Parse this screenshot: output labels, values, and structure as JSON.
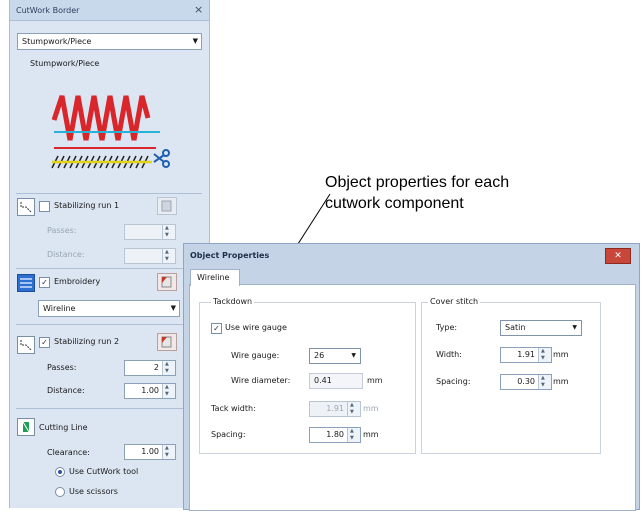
{
  "docker": {
    "title": "CutWork Border",
    "close": "×",
    "stitch_type_value": "Stumpwork/Piece",
    "preview_caption": "Stumpwork/Piece",
    "stabilizing_run_1": {
      "label": "Stabilizing run 1",
      "checked": false,
      "passes_label": "Passes:",
      "distance_label": "Distance:"
    },
    "embroidery": {
      "label": "Embroidery",
      "checked": true,
      "type_value": "Wireline"
    },
    "stabilizing_run_2": {
      "label": "Stabilizing run 2",
      "checked": true,
      "passes_label": "Passes:",
      "passes_value": "2",
      "distance_label": "Distance:",
      "distance_value": "1.00"
    },
    "cutting_line": {
      "label": "Cutting Line",
      "clearance_label": "Clearance:",
      "clearance_value": "1.00",
      "option_cutwork": "Use CutWork tool",
      "option_scissors": "Use scissors",
      "selected": "Use CutWork tool"
    }
  },
  "dialog": {
    "title": "Object Properties",
    "close": "✕",
    "tab": "Wireline",
    "tackdown": {
      "title": "Tackdown",
      "use_wire_gauge_label": "Use wire gauge",
      "use_wire_gauge_checked": true,
      "wire_gauge_label": "Wire gauge:",
      "wire_gauge_value": "26",
      "wire_diameter_label": "Wire diameter:",
      "wire_diameter_value": "0.41",
      "wire_diameter_unit": "mm",
      "tack_width_label": "Tack width:",
      "tack_width_value": "1.91",
      "tack_width_unit": "mm",
      "spacing_label": "Spacing:",
      "spacing_value": "1.80",
      "spacing_unit": "mm"
    },
    "cover_stitch": {
      "title": "Cover stitch",
      "type_label": "Type:",
      "type_value": "Satin",
      "width_label": "Width:",
      "width_value": "1.91",
      "width_unit": "mm",
      "spacing_label": "Spacing:",
      "spacing_value": "0.30",
      "spacing_unit": "mm"
    }
  },
  "annotation": {
    "text": "Object properties for each\ncutwork component"
  },
  "colors": {
    "stitch_red": "#d8262a",
    "guide_cyan": "#27b3d8",
    "guide_yellow": "#e2d21a"
  }
}
